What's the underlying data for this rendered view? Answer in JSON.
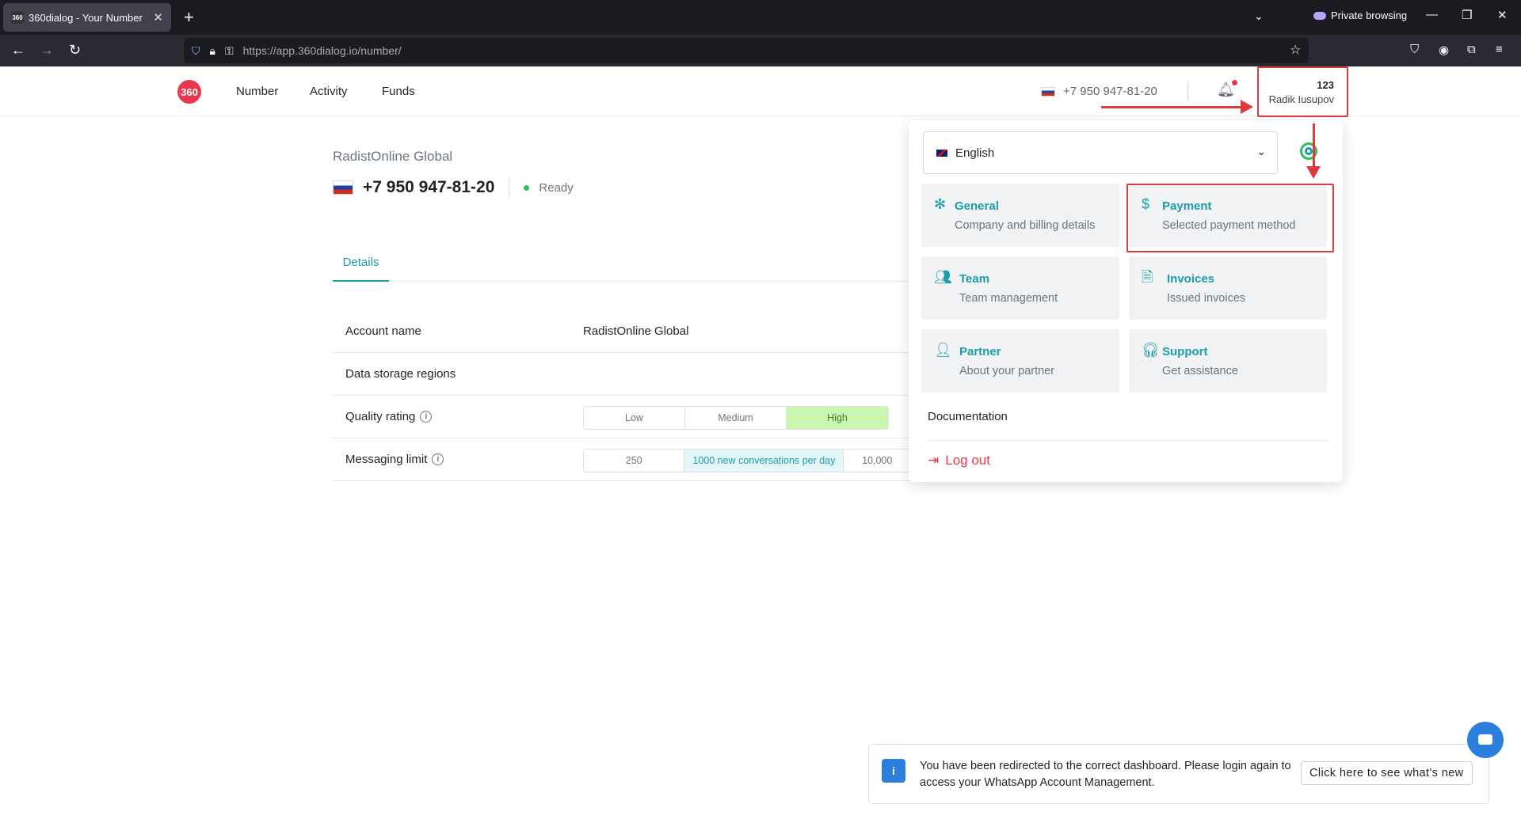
{
  "browser": {
    "tab_title": "360dialog - Your Number",
    "tab_favicon": "360",
    "private_label": "Private browsing",
    "url_host": "https://app.360dialog.io",
    "url_path": "/number/"
  },
  "header": {
    "logo_text": "360",
    "nav": [
      "Number",
      "Activity",
      "Funds"
    ],
    "phone": "+7 950 947-81-20",
    "user_count": "123",
    "user_name": "Radik Iusupov"
  },
  "main": {
    "account_title": "RadistOnline Global",
    "number": "+7 950 947-81-20",
    "status": "Ready",
    "tab": "Details",
    "rows": {
      "account_name_label": "Account name",
      "account_name_value": "RadistOnline Global",
      "storage_label": "Data storage regions",
      "quality_label": "Quality rating",
      "quality_options": [
        "Low",
        "Medium",
        "High"
      ],
      "limit_label": "Messaging limit",
      "limit_options": [
        "250",
        "1000 new conversations per day",
        "10,000"
      ]
    }
  },
  "dropdown": {
    "language": "English",
    "cards": [
      {
        "title": "General",
        "sub": "Company and billing details"
      },
      {
        "title": "Payment",
        "sub": "Selected payment method"
      },
      {
        "title": "Team",
        "sub": "Team management"
      },
      {
        "title": "Invoices",
        "sub": "Issued invoices"
      },
      {
        "title": "Partner",
        "sub": "About your partner"
      },
      {
        "title": "Support",
        "sub": "Get assistance"
      }
    ],
    "documentation": "Documentation",
    "logout": "Log out"
  },
  "toast": {
    "text": "You have been redirected to the correct dashboard. Please login again to access your WhatsApp Account Management.",
    "button": "Click here to see what's new"
  },
  "colors": {
    "accent": "#1c9dac",
    "brand": "#e8384f",
    "annotation": "#e03b3b"
  }
}
